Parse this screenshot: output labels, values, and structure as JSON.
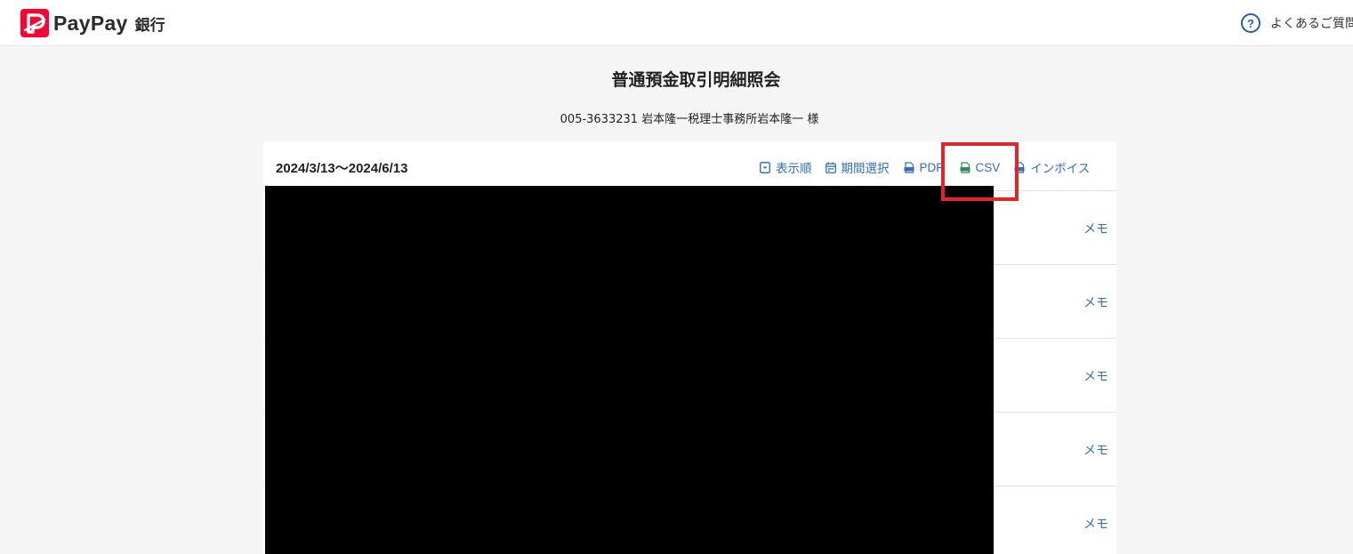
{
  "header": {
    "brand": "PayPay",
    "brand_sub": "銀行",
    "faq_label": "よくあるご質問"
  },
  "main": {
    "title": "普通預金取引明細照会",
    "account_line": "005-3633231 岩本隆一税理士事務所岩本隆一 様"
  },
  "panel": {
    "period": "2024/3/13〜2024/6/13",
    "tools": {
      "sort": "表示順",
      "period_select": "期間選択",
      "pdf": "PDF",
      "csv": "CSV",
      "invoice": "インボイス"
    },
    "rows": [
      {
        "memo": "メモ"
      },
      {
        "memo": "メモ"
      },
      {
        "memo": "メモ"
      },
      {
        "memo": "メモ"
      },
      {
        "memo": "メモ"
      }
    ]
  },
  "colors": {
    "brand_red": "#ff0033",
    "link_blue": "#2f6fb7",
    "highlight_red": "#e3252b"
  }
}
